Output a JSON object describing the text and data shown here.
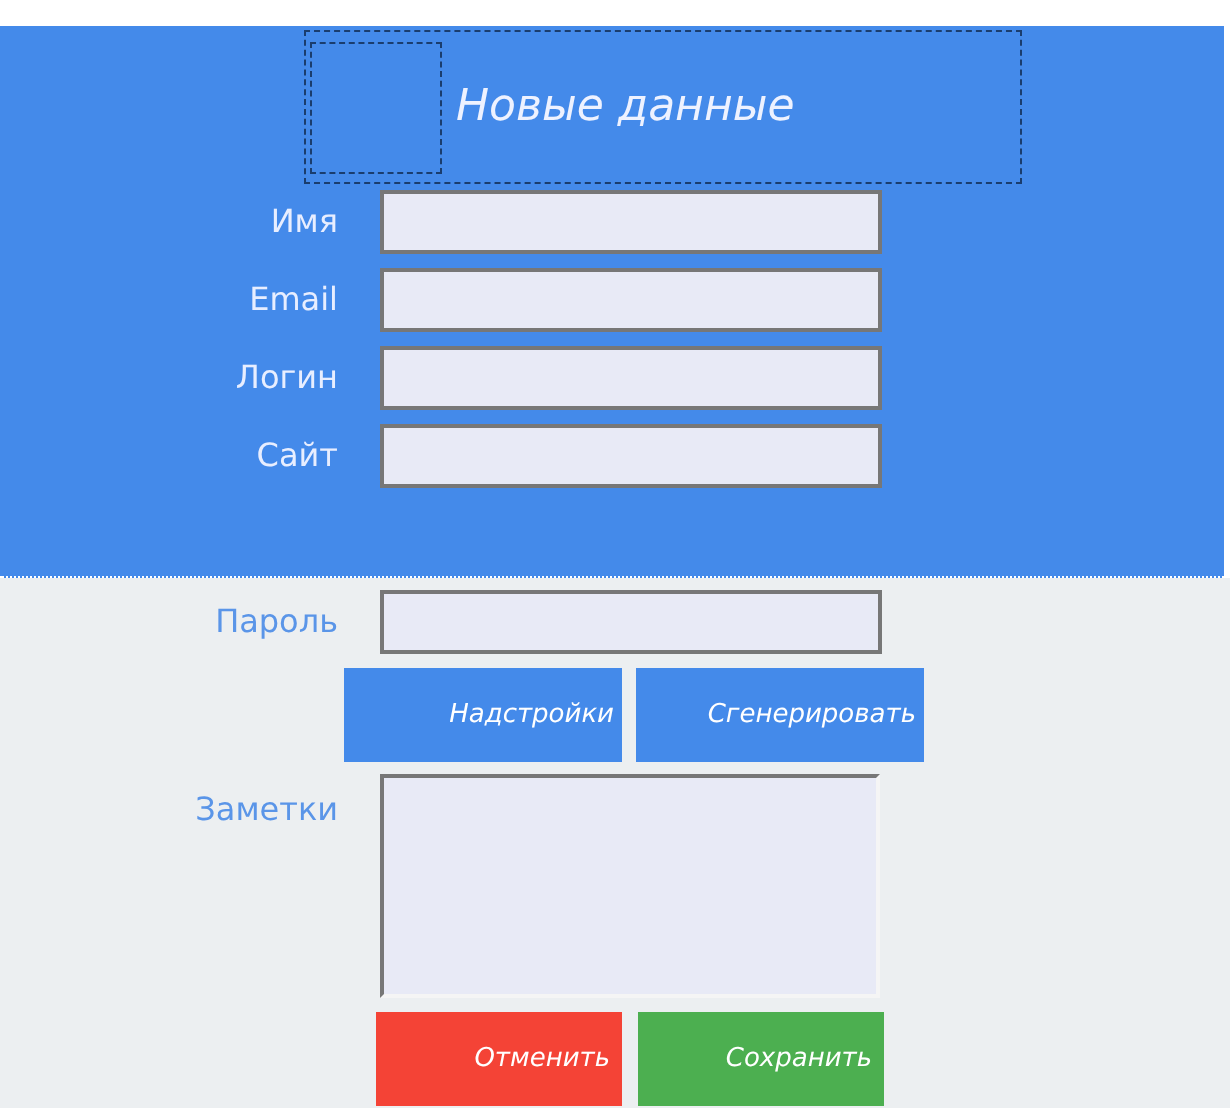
{
  "header": {
    "title": "Новые данные"
  },
  "fields": [
    {
      "label": "Имя"
    },
    {
      "label": "Email"
    },
    {
      "label": "Логин"
    },
    {
      "label": "Сайт"
    }
  ],
  "password": {
    "label": "Пароль"
  },
  "password_buttons": [
    "Надстройки",
    "Сгенерировать"
  ],
  "notes": {
    "label": "Заметки"
  },
  "actions": [
    {
      "label": "Отменить",
      "kind": "cancel"
    },
    {
      "label": "Сохранить",
      "kind": "save"
    }
  ]
}
